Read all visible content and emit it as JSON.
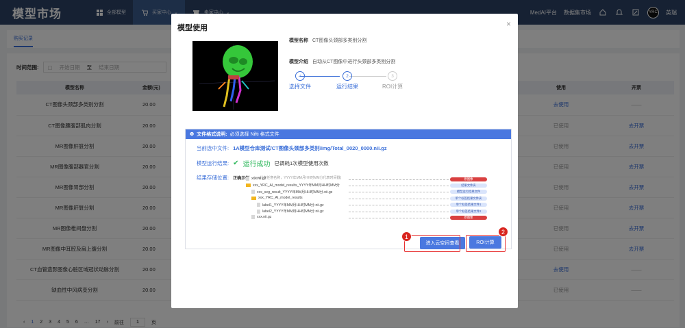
{
  "header": {
    "app_title": "模型市场",
    "nav": [
      {
        "label": "全部模型",
        "icon": "grid-icon"
      },
      {
        "label": "买家中心",
        "icon": "cart-icon"
      },
      {
        "label": "卖家中心",
        "icon": "shop-icon"
      }
    ],
    "right_links": [
      "MedAI平台",
      "数据集市场"
    ],
    "user_name": "英瑞",
    "avatar_text": "YRC"
  },
  "tabs": {
    "active": "购买记录"
  },
  "filter": {
    "label": "时间范围:",
    "start_placeholder": "开始日期",
    "separator": "至",
    "end_placeholder": "结束日期"
  },
  "table": {
    "headers": {
      "name": "模型名称",
      "amount": "金额(元)",
      "use": "使用",
      "invoice": "开票"
    },
    "rows": [
      {
        "name": "CT图像头颈部多类别分割",
        "amount": "20.00",
        "use": "去使用",
        "invoice": "——"
      },
      {
        "name": "CT图像腰腹部肌肉分割",
        "amount": "20.00",
        "use": "已使用",
        "invoice": "去开票"
      },
      {
        "name": "MR图像肝脏分割",
        "amount": "20.00",
        "use": "已使用",
        "invoice": "去开票"
      },
      {
        "name": "MR图像腹部器官分割",
        "amount": "20.00",
        "use": "已使用",
        "invoice": "去开票"
      },
      {
        "name": "MR图像胃部分割",
        "amount": "20.00",
        "use": "已使用",
        "invoice": "去开票"
      },
      {
        "name": "MR图像肝脏分割",
        "amount": "20.00",
        "use": "已使用",
        "invoice": "去开票"
      },
      {
        "name": "MR图像椎间盘分割",
        "amount": "20.00",
        "use": "已使用",
        "invoice": "去开票"
      },
      {
        "name": "MR图像中耳腔及肩上腹分割",
        "amount": "20.00",
        "use": "已使用",
        "invoice": "去开票"
      },
      {
        "name": "CT血管造影图像心脏区域冠状动脉分割",
        "amount": "20.00",
        "use": "去使用",
        "invoice": "——"
      },
      {
        "name": "缺血性中风病变分割",
        "amount": "20.00",
        "use": "已使用",
        "invoice": "——"
      }
    ]
  },
  "pagination": {
    "prev": "‹",
    "pages": [
      "1",
      "2",
      "3",
      "4",
      "5",
      "6",
      "…",
      "17"
    ],
    "next": "›",
    "goto_label": "前往",
    "goto_value": "1",
    "page_suffix": "页"
  },
  "modal": {
    "title": "模型使用",
    "close": "×",
    "model_name_label": "模型名称",
    "model_name": "CT图像头颈部多类别分割",
    "model_desc_label": "模型介绍",
    "model_desc": "自动从CT图像中进行头颈部多类别分割",
    "steps": [
      {
        "num": "✓",
        "label": "选择文件",
        "state": "done"
      },
      {
        "num": "2",
        "label": "运行结果",
        "state": "active"
      },
      {
        "num": "3",
        "label": "ROI计算",
        "state": "pending"
      }
    ],
    "notice_label": "文件格式说明:",
    "notice_text": "必须选择 Nifti 格式文件",
    "current_file_label": "当前选中文件:",
    "current_file": "1A模型仓库测试/CT图像头颈部多类别/img/Total_0020_0000.nii.gz",
    "result_label": "模型运行结果:",
    "result_status": "运行成功",
    "result_note": "已调耗1次模型使用次数",
    "storage_label": "结果存储位置:",
    "example_label": "正确示例",
    "example_note": "(xxx代表任意名称，YYYY年MM月HH时MM分代表时间戳)",
    "tree": [
      {
        "name": "xxx.nii.gz",
        "kind": "file",
        "tag": "原图像",
        "tag_color": "red"
      },
      {
        "name": "xxx_YRC_AI_model_results_YYYY年MM月HH时MM分",
        "kind": "folder",
        "tag": "结果文件夹",
        "tag_color": "blue"
      },
      {
        "name": "xxx_seg_result_YYYY年MM月HH时MM分.nii.gz",
        "kind": "file",
        "tag": "模型运行结果文件",
        "tag_color": "blue"
      },
      {
        "name": "xxx_YRC_AI_model_results",
        "kind": "folder",
        "tag": "单个标签结果文件夹",
        "tag_color": "blue"
      },
      {
        "name": "label1_YYYY年MM月HH时MM分.nii.gz",
        "kind": "file",
        "tag": "单个标签结果文件1",
        "tag_color": "blue"
      },
      {
        "name": "label2_YYYY年MM月HH时MM分.nii.gz",
        "kind": "file",
        "tag": "单个标签结果文件2",
        "tag_color": "blue"
      },
      {
        "name": "xxx.nii.gz",
        "kind": "file",
        "tag": "原图像",
        "tag_color": "red"
      }
    ],
    "cloud_button": "进入云空间查看",
    "roi_button": "ROI计算",
    "markers": [
      "1",
      "2"
    ]
  }
}
